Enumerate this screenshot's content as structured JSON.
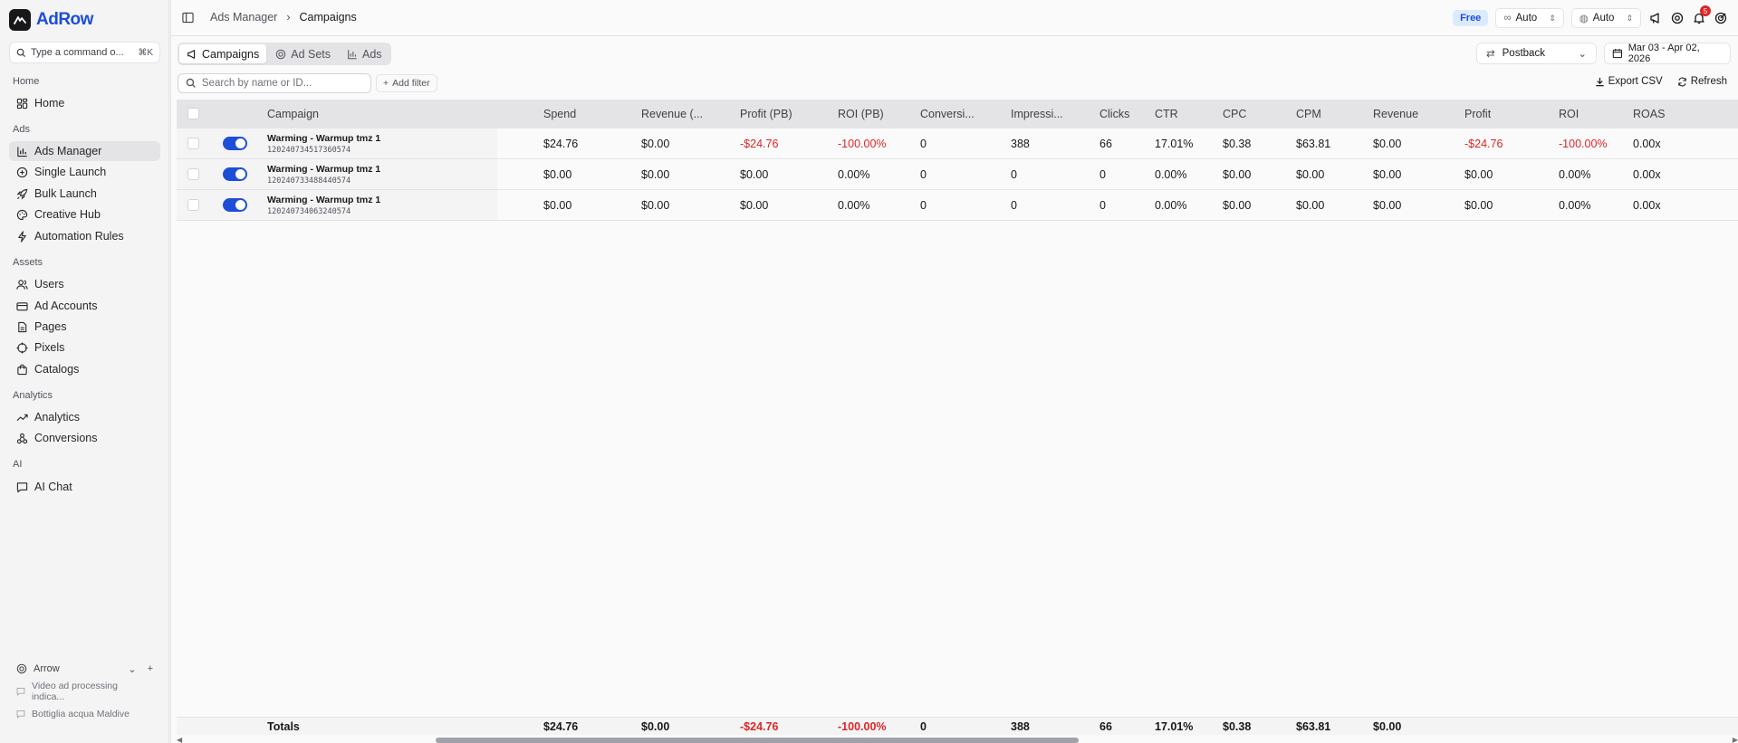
{
  "app": {
    "logo_text": "AdRow"
  },
  "sidebar": {
    "command_placeholder": "Type a command o...",
    "command_kbd": "⌘K",
    "sections": {
      "home": "Home",
      "ads": "Ads",
      "assets": "Assets",
      "analytics": "Analytics",
      "ai": "AI"
    },
    "items": {
      "home": "Home",
      "ads_manager": "Ads Manager",
      "single_launch": "Single Launch",
      "bulk_launch": "Bulk Launch",
      "creative_hub": "Creative Hub",
      "automation_rules": "Automation Rules",
      "users": "Users",
      "ad_accounts": "Ad Accounts",
      "pages": "Pages",
      "pixels": "Pixels",
      "catalogs": "Catalogs",
      "analytics": "Analytics",
      "conversions": "Conversions",
      "ai_chat": "AI Chat"
    },
    "workspace": {
      "name": "Arrow",
      "items": [
        "Video ad processing indica...",
        "Bottiglia acqua Maldive"
      ]
    }
  },
  "topbar": {
    "breadcrumb": [
      "Ads Manager",
      "Campaigns"
    ],
    "plan_badge": "Free",
    "select_1": "Auto",
    "select_2": "Auto",
    "notification_count": "5"
  },
  "tabs": [
    "Campaigns",
    "Ad Sets",
    "Ads"
  ],
  "toolbar": {
    "attribution": "Postback",
    "date_range": "Mar 03 - Apr 02, 2026",
    "search_placeholder": "Search by name or ID...",
    "add_filter": "Add filter",
    "export": "Export CSV",
    "refresh": "Refresh"
  },
  "table": {
    "columns": [
      "Campaign",
      "Spend",
      "Revenue (...",
      "Profit (PB)",
      "ROI (PB)",
      "Conversi...",
      "Impressi...",
      "Clicks",
      "CTR",
      "CPC",
      "CPM",
      "Revenue",
      "Profit",
      "ROI",
      "ROAS"
    ],
    "rows": [
      {
        "name": "Warming - Warmup tmz 1",
        "id": "120240734517360574",
        "cells": [
          "$24.76",
          "$0.00",
          "-$24.76",
          "-100.00%",
          "0",
          "388",
          "66",
          "17.01%",
          "$0.38",
          "$63.81",
          "$0.00",
          "-$24.76",
          "-100.00%",
          "0.00x"
        ]
      },
      {
        "name": "Warming - Warmup tmz 1",
        "id": "120240733488440574",
        "cells": [
          "$0.00",
          "$0.00",
          "$0.00",
          "0.00%",
          "0",
          "0",
          "0",
          "0.00%",
          "$0.00",
          "$0.00",
          "$0.00",
          "$0.00",
          "0.00%",
          "0.00x"
        ]
      },
      {
        "name": "Warming - Warmup tmz 1",
        "id": "120240734063240574",
        "cells": [
          "$0.00",
          "$0.00",
          "$0.00",
          "0.00%",
          "0",
          "0",
          "0",
          "0.00%",
          "$0.00",
          "$0.00",
          "$0.00",
          "$0.00",
          "0.00%",
          "0.00x"
        ]
      }
    ],
    "totals_label": "Totals",
    "totals": [
      "$24.76",
      "$0.00",
      "-$24.76",
      "-100.00%",
      "0",
      "388",
      "66",
      "17.01%",
      "$0.38",
      "$63.81",
      "$0.00"
    ]
  },
  "colors": {
    "accent": "#1d4ed8",
    "negative": "#dc2626"
  }
}
